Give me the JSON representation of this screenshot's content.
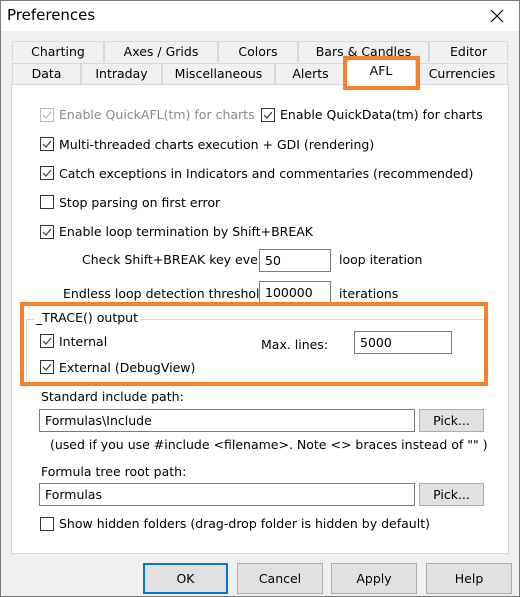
{
  "window": {
    "title": "Preferences",
    "close_icon": "close-icon"
  },
  "tabs": {
    "row1": [
      "Charting",
      "Axes / Grids",
      "Colors",
      "Bars & Candles",
      "Editor"
    ],
    "row2": [
      "Data",
      "Intraday",
      "Miscellaneous",
      "Alerts",
      "AFL",
      "Currencies"
    ],
    "selected": "AFL"
  },
  "afl": {
    "quickafl": {
      "label": "Enable QuickAFL(tm) for charts",
      "checked": true,
      "disabled": true
    },
    "quickdata": {
      "label": "Enable QuickData(tm) for charts",
      "checked": true
    },
    "multithreaded": {
      "label": "Multi-threaded charts execution + GDI (rendering)",
      "checked": true
    },
    "catch_exceptions": {
      "label": "Catch exceptions in Indicators and commentaries (recommended)",
      "checked": true
    },
    "stop_parsing": {
      "label": "Stop parsing on first error",
      "checked": false
    },
    "loop_termination": {
      "label": "Enable loop termination by Shift+BREAK",
      "checked": true
    },
    "check_every": {
      "label": "Check Shift+BREAK key every:",
      "value": "50",
      "suffix": "loop iteration"
    },
    "endless_threshold": {
      "label": "Endless loop detection threshold:",
      "value": "100000",
      "suffix": "iterations"
    },
    "trace_group": {
      "title": "_TRACE() output",
      "internal": {
        "label": "Internal",
        "checked": true
      },
      "external": {
        "label": "External (DebugView)",
        "checked": true
      },
      "max_lines_label": "Max. lines:",
      "max_lines_value": "5000"
    },
    "include_path": {
      "label": "Standard include path:",
      "value": "Formulas\\Include",
      "pick_label": "Pick...",
      "note": "(used if you use #include <filename>. Note <> braces instead of \"\" )"
    },
    "tree_root": {
      "label": "Formula tree root path:",
      "value": "Formulas",
      "pick_label": "Pick..."
    },
    "show_hidden": {
      "label": "Show hidden folders (drag-drop folder is hidden by default)",
      "checked": false
    }
  },
  "buttons": {
    "ok": "OK",
    "cancel": "Cancel",
    "apply": "Apply",
    "help": "Help"
  },
  "colors": {
    "highlight": "#f6802b",
    "default_button_border": "#0078d7"
  }
}
